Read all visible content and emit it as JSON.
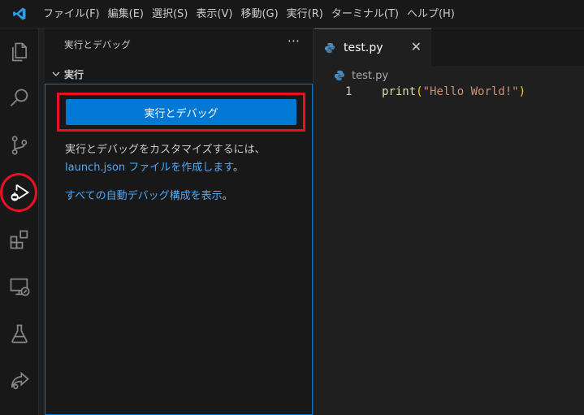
{
  "menubar": {
    "items": [
      "ファイル(F)",
      "編集(E)",
      "選択(S)",
      "表示(V)",
      "移動(G)",
      "実行(R)",
      "ターミナル(T)",
      "ヘルプ(H)"
    ]
  },
  "activitybar": {
    "icons": [
      "explorer-icon",
      "search-icon",
      "source-control-icon",
      "run-debug-icon",
      "extensions-icon",
      "remote-explorer-icon",
      "testing-icon",
      "remote-share-icon"
    ]
  },
  "sidebar": {
    "title": "実行とデバッグ",
    "more": "···",
    "section_label": "実行",
    "run_button": "実行とデバッグ",
    "desc_line1": "実行とデバッグをカスタマイズするには、",
    "desc_link": "launch.json ファイルを作成します",
    "desc_suffix": "。",
    "link2": "すべての自動デバッグ構成を表示",
    "link2_suffix": "。"
  },
  "editor": {
    "tab_label": "test.py",
    "close": "✕",
    "breadcrumb": "test.py",
    "line_number": "1",
    "code_fn": "print",
    "code_open": "(",
    "code_str": "\"Hello World!\"",
    "code_close": ")"
  },
  "colors": {
    "accent": "#0078d4",
    "highlight": "#e81123",
    "link": "#4daafc"
  }
}
